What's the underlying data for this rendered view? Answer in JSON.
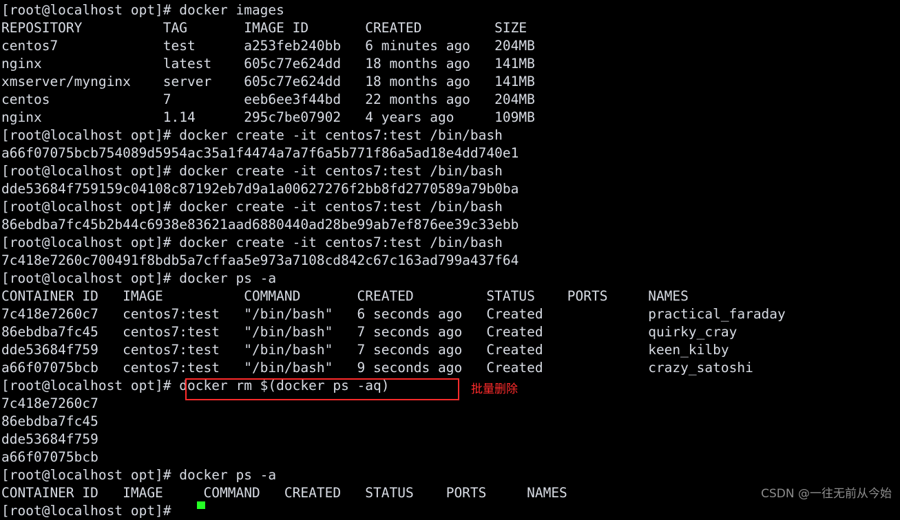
{
  "terminal": {
    "prompt": "[root@localhost opt]# ",
    "lines": [
      "[root@localhost opt]# docker images",
      "REPOSITORY          TAG       IMAGE ID       CREATED         SIZE",
      "centos7             test      a253feb240bb   6 minutes ago   204MB",
      "nginx               latest    605c77e624dd   18 months ago   141MB",
      "xmserver/mynginx    server    605c77e624dd   18 months ago   141MB",
      "centos              7         eeb6ee3f44bd   22 months ago   204MB",
      "nginx               1.14      295c7be07902   4 years ago     109MB",
      "[root@localhost opt]# docker create -it centos7:test /bin/bash",
      "a66f07075bcb754089d5954ac35a1f4474a7a7f6a5b771f86a5ad18e4dd740e1",
      "[root@localhost opt]# docker create -it centos7:test /bin/bash",
      "dde53684f759159c04108c87192eb7d9a1a00627276f2bb8fd2770589a79b0ba",
      "[root@localhost opt]# docker create -it centos7:test /bin/bash",
      "86ebdba7fc45b2b44c6938e83621aad6880440ad28be99ab7ef876ee39c33ebb",
      "[root@localhost opt]# docker create -it centos7:test /bin/bash",
      "7c418e7260c700491f8bdb5a7cffaa5e973a7108cd842c67c163ad799a437f64",
      "[root@localhost opt]# docker ps -a",
      "CONTAINER ID   IMAGE          COMMAND       CREATED         STATUS    PORTS     NAMES",
      "7c418e7260c7   centos7:test   \"/bin/bash\"   6 seconds ago   Created             practical_faraday",
      "86ebdba7fc45   centos7:test   \"/bin/bash\"   7 seconds ago   Created             quirky_cray",
      "dde53684f759   centos7:test   \"/bin/bash\"   7 seconds ago   Created             keen_kilby",
      "a66f07075bcb   centos7:test   \"/bin/bash\"   9 seconds ago   Created             crazy_satoshi",
      "[root@localhost opt]# docker rm $(docker ps -aq)",
      "7c418e7260c7",
      "86ebdba7fc45",
      "dde53684f759",
      "a66f07075bcb",
      "[root@localhost opt]# docker ps -a",
      "CONTAINER ID   IMAGE     COMMAND   CREATED   STATUS    PORTS     NAMES",
      "[root@localhost opt]# "
    ],
    "commands": {
      "docker_images": "docker images",
      "docker_create": "docker create -it centos7:test /bin/bash",
      "docker_ps_a": "docker ps -a",
      "docker_rm_all": "docker rm $(docker ps -aq)"
    },
    "images_table": {
      "headers": [
        "REPOSITORY",
        "TAG",
        "IMAGE ID",
        "CREATED",
        "SIZE"
      ],
      "rows": [
        [
          "centos7",
          "test",
          "a253feb240bb",
          "6 minutes ago",
          "204MB"
        ],
        [
          "nginx",
          "latest",
          "605c77e624dd",
          "18 months ago",
          "141MB"
        ],
        [
          "xmserver/mynginx",
          "server",
          "605c77e624dd",
          "18 months ago",
          "141MB"
        ],
        [
          "centos",
          "7",
          "eeb6ee3f44bd",
          "22 months ago",
          "204MB"
        ],
        [
          "nginx",
          "1.14",
          "295c7be07902",
          "4 years ago",
          "109MB"
        ]
      ]
    },
    "ps_table": {
      "headers": [
        "CONTAINER ID",
        "IMAGE",
        "COMMAND",
        "CREATED",
        "STATUS",
        "PORTS",
        "NAMES"
      ],
      "rows": [
        [
          "7c418e7260c7",
          "centos7:test",
          "\"/bin/bash\"",
          "6 seconds ago",
          "Created",
          "",
          "practical_faraday"
        ],
        [
          "86ebdba7fc45",
          "centos7:test",
          "\"/bin/bash\"",
          "7 seconds ago",
          "Created",
          "",
          "quirky_cray"
        ],
        [
          "dde53684f759",
          "centos7:test",
          "\"/bin/bash\"",
          "7 seconds ago",
          "Created",
          "",
          "keen_kilby"
        ],
        [
          "a66f07075bcb",
          "centos7:test",
          "\"/bin/bash\"",
          "9 seconds ago",
          "Created",
          "",
          "crazy_satoshi"
        ]
      ]
    },
    "created_container_ids": [
      "a66f07075bcb754089d5954ac35a1f4474a7a7f6a5b771f86a5ad18e4dd740e1",
      "dde53684f759159c04108c87192eb7d9a1a00627276f2bb8fd2770589a79b0ba",
      "86ebdba7fc45b2b44c6938e83621aad6880440ad28be99ab7ef876ee39c33ebb",
      "7c418e7260c700491f8bdb5a7cffaa5e973a7108cd842c67c163ad799a437f64"
    ],
    "removed_container_ids": [
      "7c418e7260c7",
      "86ebdba7fc45",
      "dde53684f759",
      "a66f07075bcb"
    ]
  },
  "annotation": {
    "note": "批量删除",
    "box_color": "#ff2b2b"
  },
  "watermark": {
    "text": "CSDN @一往无前从今始"
  },
  "colors": {
    "background": "#000000",
    "foreground": "#d8dce4",
    "accent_red": "#ff2b2b",
    "cursor_green": "#25ff25"
  }
}
